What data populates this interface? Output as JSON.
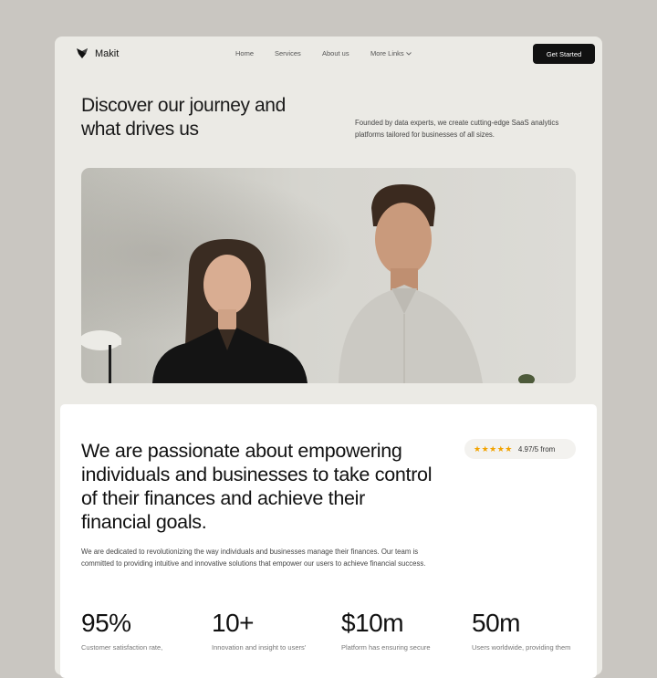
{
  "nav": {
    "brand": "Makit",
    "links": [
      "Home",
      "Services",
      "About us",
      "More Links"
    ],
    "cta": "Get Started"
  },
  "hero": {
    "title": "Discover our journey and what drives us",
    "description": "Founded by data experts, we create cutting-edge SaaS analytics platforms tailored for businesses of all sizes."
  },
  "about": {
    "headline": "We are passionate about empowering individuals and businesses to take control of their finances and achieve their financial goals.",
    "rating": {
      "stars": 5,
      "text": "4.97/5 from"
    },
    "body": "We are dedicated to revolutionizing the way individuals and businesses manage their finances. Our team is committed to providing intuitive and innovative solutions that empower our users to achieve financial success.",
    "stats": [
      {
        "value": "95%",
        "desc": "Customer satisfaction rate,"
      },
      {
        "value": "10+",
        "desc": "Innovation and insight to users'"
      },
      {
        "value": "$10m",
        "desc": "Platform has ensuring secure"
      },
      {
        "value": "50m",
        "desc": "Users worldwide, providing them"
      }
    ]
  },
  "colors": {
    "background": "#c9c6c1",
    "card": "#ebeae5",
    "button": "#111111",
    "star": "#f2a300"
  }
}
